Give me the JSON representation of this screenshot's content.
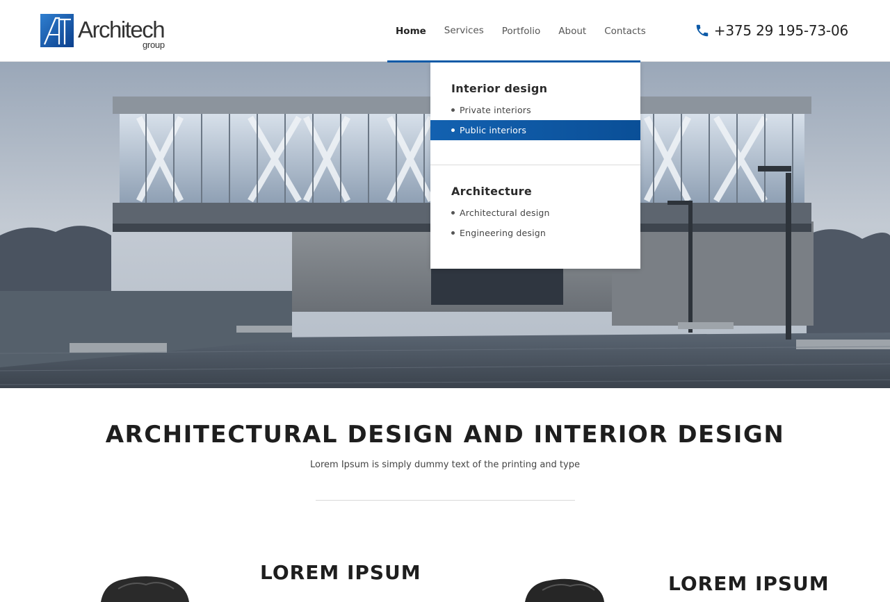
{
  "header": {
    "logo": {
      "word": "Architech",
      "sub": "group",
      "icon": "architech-logo-icon"
    },
    "nav": {
      "home": "Home",
      "services": "Services",
      "portfolio": "Portfolio",
      "about": "About",
      "contacts": "Contacts"
    },
    "phone": {
      "icon": "phone-icon",
      "number": "+375 29 195-73-06"
    }
  },
  "services_menu": {
    "groups": [
      {
        "heading": "Interior design",
        "items": [
          {
            "label": "Private interiors",
            "active": false
          },
          {
            "label": "Public interiors",
            "active": true
          }
        ]
      },
      {
        "heading": "Architecture",
        "items": [
          {
            "label": "Architectural design",
            "active": false
          },
          {
            "label": "Engineering design",
            "active": false
          }
        ]
      }
    ]
  },
  "main": {
    "title": "ARCHITECTURAL DESIGN AND INTERIOR DESIGN",
    "subtitle": "Lorem Ipsum is simply dummy text of the printing and type"
  },
  "features": [
    {
      "title": "LOREM IPSUM"
    },
    {
      "title": "LOREM IPSUM"
    }
  ],
  "colors": {
    "accent": "#0d5aa7",
    "active_item": "#1361b0",
    "text": "#222222"
  }
}
